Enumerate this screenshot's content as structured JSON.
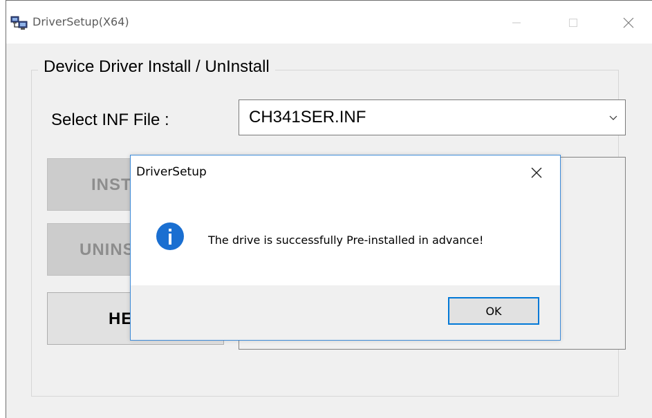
{
  "window": {
    "title": "DriverSetup(X64)",
    "app_icon": "computer-network-icon"
  },
  "main": {
    "group_title": "Device Driver Install / UnInstall",
    "inf_label": "Select INF File :",
    "inf_selected": "CH341SER.INF",
    "buttons": {
      "install": "INSTALL",
      "uninstall": "UNINSTALL",
      "help": "HELP"
    }
  },
  "dialog": {
    "title": "DriverSetup",
    "message": "The drive is successfully Pre-installed in advance!",
    "ok_label": "OK",
    "icon": "info-icon",
    "accent_color": "#1a6fd1"
  }
}
